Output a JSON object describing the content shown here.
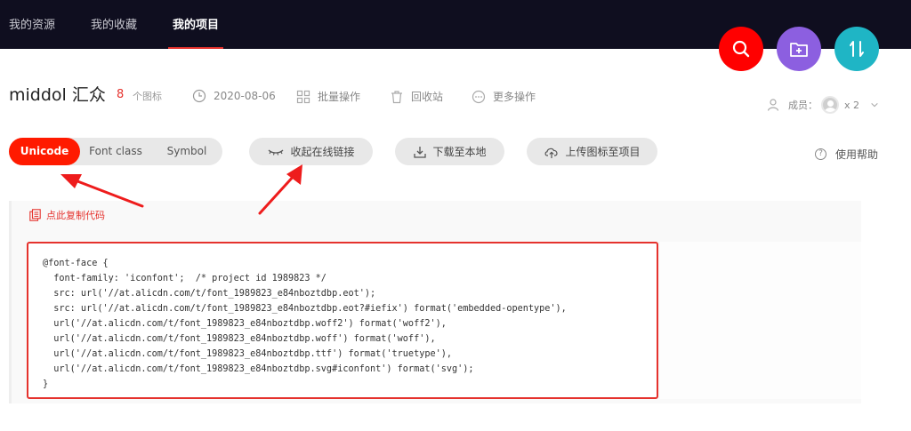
{
  "nav": {
    "tabs": [
      {
        "label": "我的资源"
      },
      {
        "label": "我的收藏"
      },
      {
        "label": "我的项目"
      }
    ],
    "active_tab": "我的项目",
    "actions": [
      {
        "icon": "search-icon",
        "color": "#ff0000"
      },
      {
        "icon": "folder-add-icon",
        "color": "#8c5fe0"
      },
      {
        "icon": "sort-icon",
        "color": "#1fb5c5"
      }
    ]
  },
  "project": {
    "name": "middol 汇众",
    "icon_count": "8",
    "icon_count_label": "个图标",
    "date": "2020-08-06",
    "batch_label": "批量操作",
    "recycle_label": "回收站",
    "more_label": "更多操作",
    "members_label": "成员：",
    "members_count": "x 2"
  },
  "format_tabs": [
    {
      "label": "Unicode"
    },
    {
      "label": "Font class"
    },
    {
      "label": "Symbol"
    }
  ],
  "active_format": "Unicode",
  "toolbar": {
    "collapse_link_label": "收起在线链接",
    "download_label": "下载至本地",
    "upload_label": "上传图标至项目",
    "help_label": "使用帮助",
    "help_glyph": "?"
  },
  "code": {
    "copy_label": "点此复制代码",
    "content": "@font-face {\n  font-family: 'iconfont';  /* project id 1989823 */\n  src: url('//at.alicdn.com/t/font_1989823_e84nboztdbp.eot');\n  src: url('//at.alicdn.com/t/font_1989823_e84nboztdbp.eot?#iefix') format('embedded-opentype'),\n  url('//at.alicdn.com/t/font_1989823_e84nboztdbp.woff2') format('woff2'),\n  url('//at.alicdn.com/t/font_1989823_e84nboztdbp.woff') format('woff'),\n  url('//at.alicdn.com/t/font_1989823_e84nboztdbp.ttf') format('truetype'),\n  url('//at.alicdn.com/t/font_1989823_e84nboztdbp.svg#iconfont') format('svg');\n}"
  },
  "colors": {
    "nav_bg": "#0f0e1f",
    "accent": "#ff1a00",
    "highlight_border": "#e5322d"
  }
}
